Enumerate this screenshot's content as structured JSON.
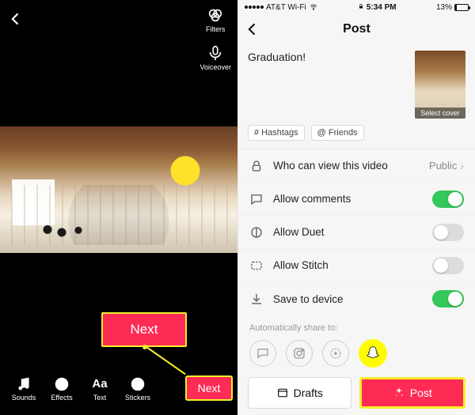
{
  "left": {
    "tools": {
      "filters": "Filters",
      "voiceover": "Voiceover"
    },
    "callout_next": "Next",
    "bottom": {
      "sounds": "Sounds",
      "effects": "Effects",
      "text": "Text",
      "text_symbol": "Aa",
      "stickers": "Stickers",
      "next": "Next"
    }
  },
  "right": {
    "status": {
      "carrier": "AT&T Wi-Fi",
      "time": "5:34 PM",
      "battery_pct": "13%",
      "battery_level": 13
    },
    "header": {
      "title": "Post"
    },
    "caption": "Graduation!",
    "cover_label": "Select cover",
    "chips": {
      "hashtags": "# Hashtags",
      "friends": "@ Friends"
    },
    "settings": {
      "privacy_label": "Who can view this video",
      "privacy_value": "Public",
      "comments_label": "Allow comments",
      "comments_on": true,
      "duet_label": "Allow Duet",
      "duet_on": false,
      "stitch_label": "Allow Stitch",
      "stitch_on": false,
      "save_label": "Save to device",
      "save_on": true
    },
    "share_label": "Automatically share to:",
    "footer": {
      "drafts": "Drafts",
      "post": "Post"
    }
  }
}
